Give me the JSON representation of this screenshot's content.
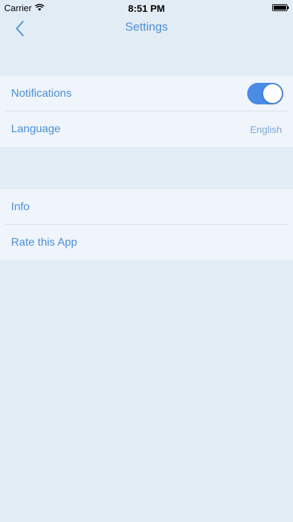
{
  "status_bar": {
    "carrier": "Carrier",
    "time": "8:51 PM",
    "wifi_icon": "wifi-icon",
    "battery_icon": "battery-icon"
  },
  "nav": {
    "title": "Settings",
    "back_icon": "chevron-left-icon"
  },
  "settings": {
    "group1": [
      {
        "label": "Notifications",
        "type": "toggle",
        "on": true
      },
      {
        "label": "Language",
        "type": "value",
        "value": "English"
      }
    ],
    "group2": [
      {
        "label": "Info"
      },
      {
        "label": "Rate this App"
      }
    ]
  },
  "colors": {
    "background": "#e2ecf5",
    "cell": "#eff5fa",
    "accent": "#4a8fd6",
    "toggle_on": "#4a8be6",
    "secondary_text": "#7fa8d6"
  }
}
